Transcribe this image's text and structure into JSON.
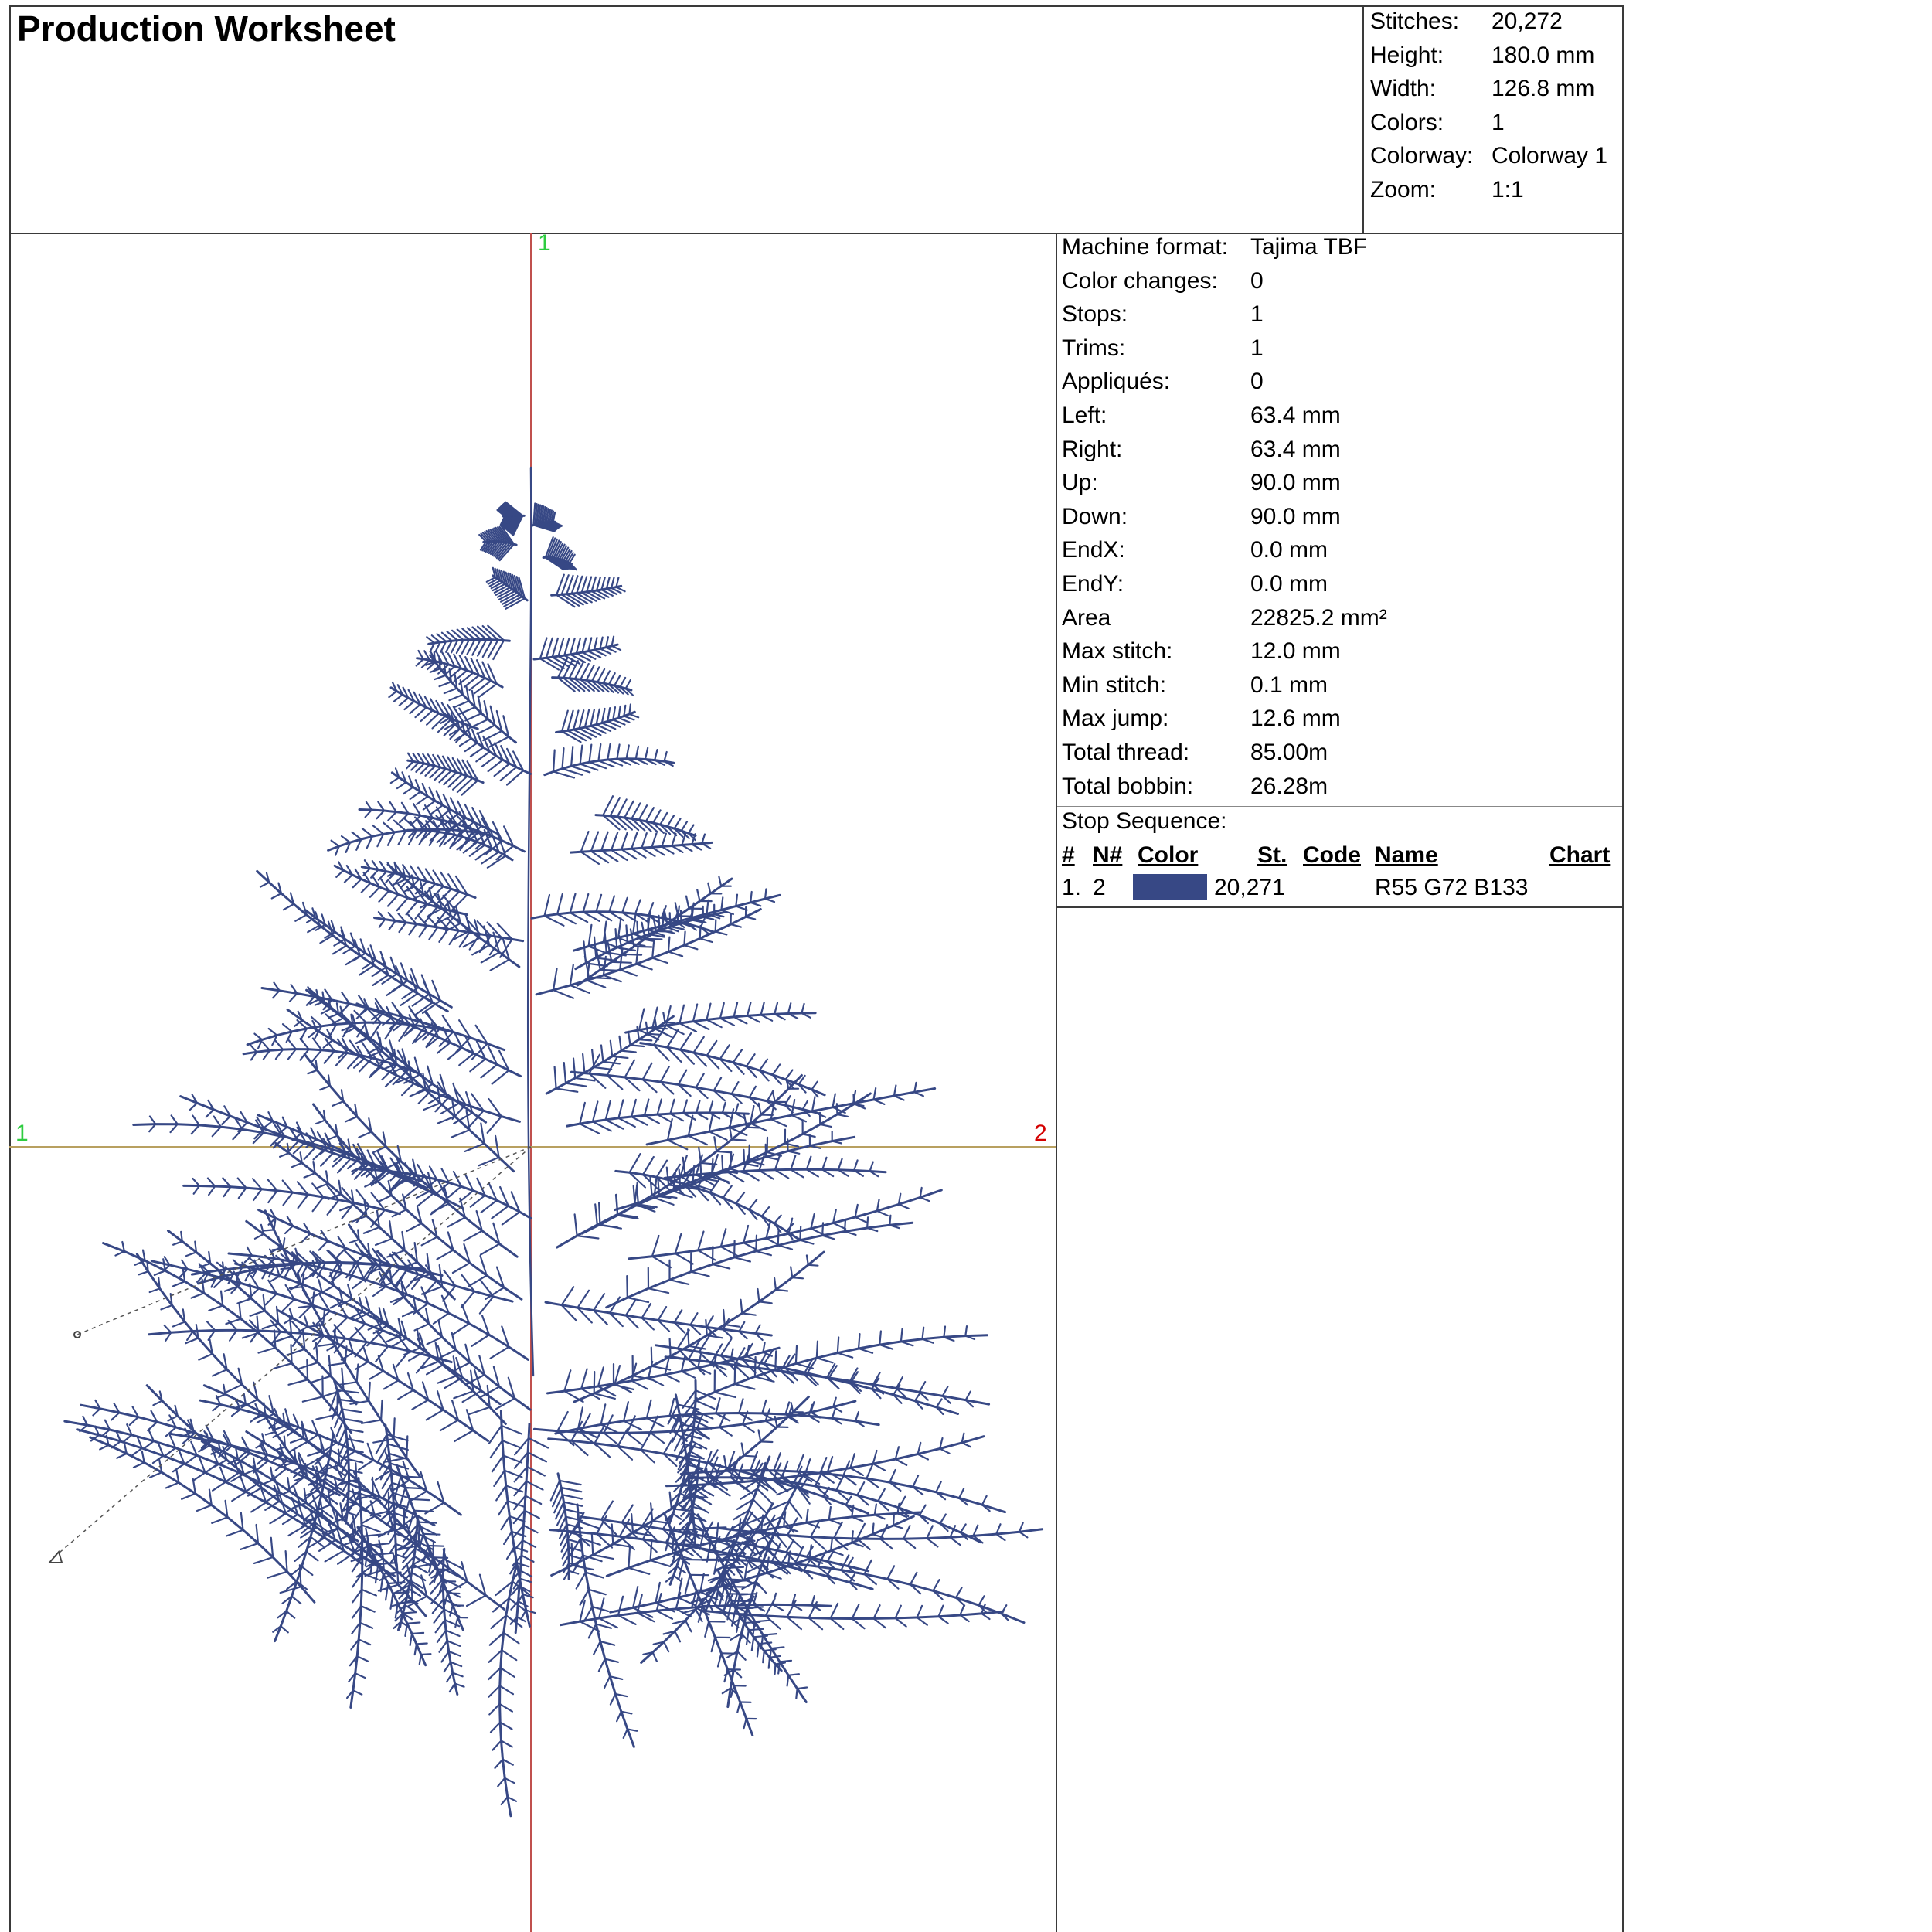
{
  "title": "Production Worksheet",
  "summary": [
    {
      "label": "Stitches:",
      "value": "20,272"
    },
    {
      "label": "Height:",
      "value": "180.0 mm"
    },
    {
      "label": "Width:",
      "value": "126.8 mm"
    },
    {
      "label": "Colors:",
      "value": "1"
    },
    {
      "label": "Colorway:",
      "value": "Colorway 1"
    },
    {
      "label": "Zoom:",
      "value": "1:1"
    }
  ],
  "stats": [
    {
      "label": "Machine format:",
      "value": "Tajima TBF"
    },
    {
      "label": "Color changes:",
      "value": "0"
    },
    {
      "label": "Stops:",
      "value": "1"
    },
    {
      "label": "Trims:",
      "value": "1"
    },
    {
      "label": "Appliqués:",
      "value": "0"
    },
    {
      "label": "Left:",
      "value": "63.4 mm"
    },
    {
      "label": "Right:",
      "value": "63.4 mm"
    },
    {
      "label": "Up:",
      "value": "90.0 mm"
    },
    {
      "label": "Down:",
      "value": "90.0 mm"
    },
    {
      "label": "EndX:",
      "value": "0.0 mm"
    },
    {
      "label": "EndY:",
      "value": "0.0 mm"
    },
    {
      "label": "Area",
      "value": "22825.2 mm²"
    },
    {
      "label": "Max stitch:",
      "value": "12.0 mm"
    },
    {
      "label": "Min stitch:",
      "value": "0.1 mm"
    },
    {
      "label": "Max jump:",
      "value": "12.6 mm"
    },
    {
      "label": "Total thread:",
      "value": "85.00m"
    },
    {
      "label": "Total bobbin:",
      "value": "26.28m"
    }
  ],
  "stop_sequence": {
    "title": "Stop Sequence:",
    "headers": {
      "num": "#",
      "needle": "N#",
      "color": "Color",
      "stitches": "St.",
      "code": "Code",
      "name": "Name",
      "chart": "Chart"
    },
    "rows": [
      {
        "num": "1.",
        "needle": "2",
        "color_hex": "#374885",
        "stitches": "20,271",
        "code": "",
        "name": "R55 G72 B133",
        "chart": ""
      }
    ]
  },
  "axis_labels": {
    "top": "1",
    "left": "1",
    "right": "2"
  },
  "colors": {
    "thread": "#374885",
    "axis_vertical": "#c0504d",
    "axis_horizontal": "#b8a060",
    "label_green": "#2ecc40",
    "label_red": "#d40000"
  },
  "design_icon": "embroidery-pine-tree"
}
